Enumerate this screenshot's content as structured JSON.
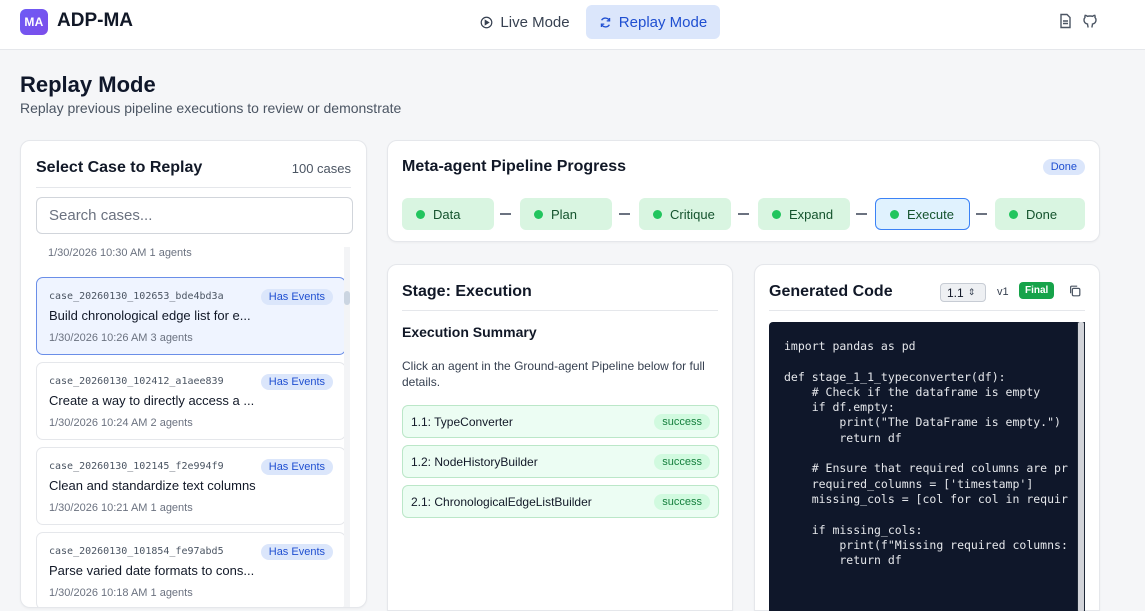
{
  "app": {
    "logo_text": "MA",
    "title": "ADP-MA"
  },
  "nav": {
    "live_mode": "Live Mode",
    "replay_mode": "Replay Mode"
  },
  "page": {
    "title": "Replay Mode",
    "subtitle": "Replay previous pipeline executions to review or demonstrate"
  },
  "case_panel": {
    "title": "Select Case to Replay",
    "count": "100 cases",
    "search_placeholder": "Search cases...",
    "partial_meta": "1/30/2026 10:30 AM   1 agents",
    "items": [
      {
        "id": "case_20260130_102653_bde4bd3a",
        "badge": "Has Events",
        "name": "Build chronological edge list for e...",
        "meta": "1/30/2026 10:26 AM   3 agents"
      },
      {
        "id": "case_20260130_102412_a1aee839",
        "badge": "Has Events",
        "name": "Create a way to directly access a ...",
        "meta": "1/30/2026 10:24 AM   2 agents"
      },
      {
        "id": "case_20260130_102145_f2e994f9",
        "badge": "Has Events",
        "name": "Clean and standardize text columns",
        "meta": "1/30/2026 10:21 AM   1 agents"
      },
      {
        "id": "case_20260130_101854_fe97abd5",
        "badge": "Has Events",
        "name": "Parse varied date formats to cons...",
        "meta": "1/30/2026 10:18 AM   1 agents"
      }
    ]
  },
  "pipeline": {
    "title": "Meta-agent Pipeline Progress",
    "status": "Done",
    "stages": [
      "Data",
      "Plan",
      "Critique",
      "Expand",
      "Execute",
      "Done"
    ]
  },
  "stage_panel": {
    "title": "Stage: Execution",
    "summary_title": "Execution Summary",
    "summary_desc": "Click an agent in the Ground-agent Pipeline below for full details.",
    "agents": [
      {
        "name": "1.1: TypeConverter",
        "status": "success"
      },
      {
        "name": "1.2: NodeHistoryBuilder",
        "status": "success"
      },
      {
        "name": "2.1: ChronologicalEdgeListBuilder",
        "status": "success"
      }
    ]
  },
  "code_panel": {
    "title": "Generated Code",
    "version": "1.1",
    "version_label": "v1",
    "final_label": "Final",
    "code": "import pandas as pd\n\ndef stage_1_1_typeconverter(df):\n    # Check if the dataframe is empty\n    if df.empty:\n        print(\"The DataFrame is empty.\")\n        return df\n\n    # Ensure that required columns are pr\n    required_columns = ['timestamp']\n    missing_cols = [col for col in requir\n\n    if missing_cols:\n        print(f\"Missing required columns:\n        return df"
  },
  "colors": {
    "accent": "#1f4fd1",
    "success": "#16a34a",
    "stage_fill": "#d9f5e1",
    "code_bg": "#0f172a"
  }
}
